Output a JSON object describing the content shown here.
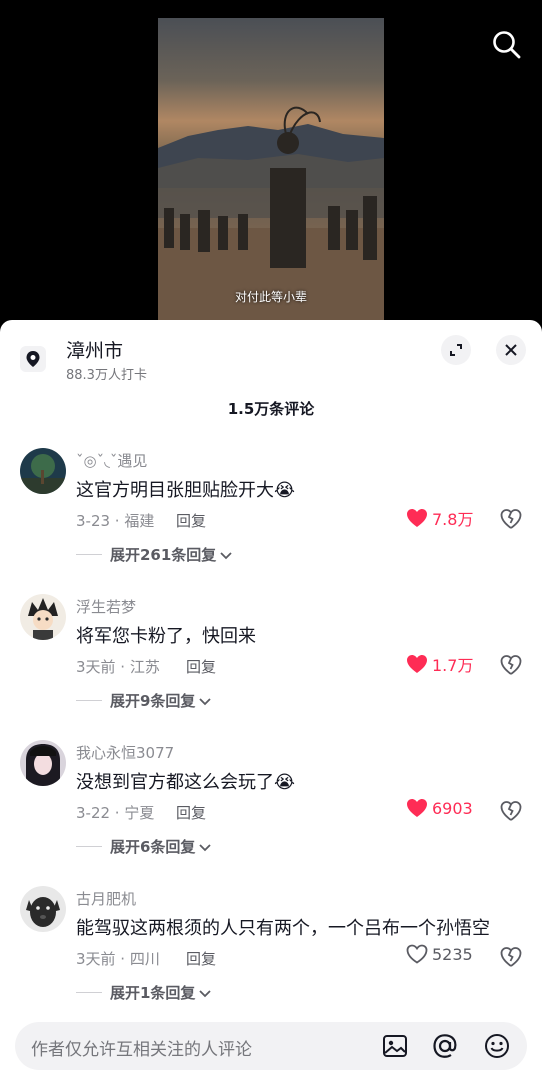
{
  "video": {
    "subtitle": "对付此等小辈",
    "search_icon": "search-icon"
  },
  "location": {
    "name": "漳州市",
    "checkins": "88.3万人打卡",
    "icon": "location-pin-icon"
  },
  "comments_header": {
    "count": "1.5万条评论"
  },
  "comments": [
    {
      "username": "ˇ◎ˇ◟ˇ遇见",
      "text": "这官方明目张胆贴脸开大😭",
      "date_location": "3-23 · 福建",
      "reply_label": "回复",
      "likes": "7.8万",
      "liked": true,
      "expand": "展开261条回复"
    },
    {
      "username": "浮生若梦",
      "text": "将军您卡粉了，快回来",
      "date_location": "3天前 · 江苏",
      "reply_label": "回复",
      "likes": "1.7万",
      "liked": true,
      "expand": "展开9条回复"
    },
    {
      "username": "我心永恒3077",
      "text": "没想到官方都这么会玩了😭",
      "date_location": "3-22 · 宁夏",
      "reply_label": "回复",
      "likes": "6903",
      "liked": true,
      "expand": "展开6条回复"
    },
    {
      "username": "古月肥机",
      "text": "能驾驭这两根须的人只有两个，一个吕布一个孙悟空",
      "date_location": "3天前 · 四川",
      "reply_label": "回复",
      "likes": "5235",
      "liked": false,
      "expand": "展开1条回复"
    }
  ],
  "input": {
    "placeholder": "作者仅允许互相关注的人评论"
  },
  "colors": {
    "accent_red": "#fe2c55",
    "text_primary": "#161823",
    "text_secondary": "#8a8b91"
  }
}
